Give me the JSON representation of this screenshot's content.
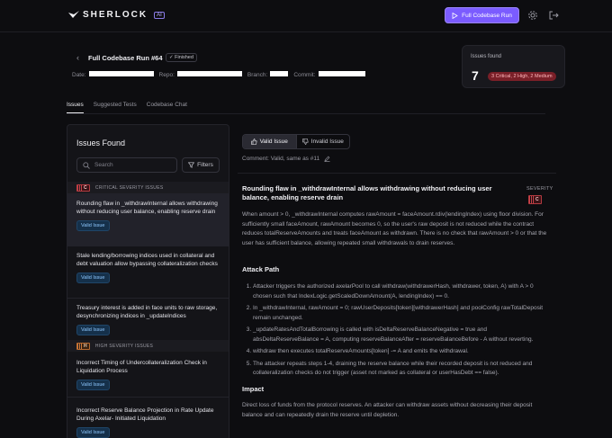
{
  "app": {
    "brand": "SHERLOCK",
    "ai_badge": "AI",
    "run_button": "Full Codebase Run"
  },
  "header": {
    "title": "Full Codebase Run #64",
    "status": "Finished",
    "meta": {
      "date_label": "Date",
      "repo_label": "Repo",
      "branch_label": "Branch",
      "commit_label": "Commit"
    }
  },
  "summary": {
    "label": "Issues found",
    "count": "7",
    "breakdown": "3 Critical, 2 High, 2 Medium"
  },
  "tabs": [
    "Issues",
    "Suggested Tests",
    "Codebase Chat"
  ],
  "issues_panel": {
    "title": "Issues Found",
    "search_placeholder": "Search",
    "filters_label": "Filters",
    "critical_header": "CRITICAL SEVERITY ISSUES",
    "high_header": "HIGH SEVERITY ISSUES",
    "severity_letters": {
      "critical": "C",
      "high": "H"
    },
    "items": [
      {
        "text": "Rounding flaw in _withdrawInternal allows withdrawing without reducing user balance, enabling reserve drain",
        "badge": "Valid Issue"
      },
      {
        "text": "Stale lending/borrowing indices used in collateral and debt valuation allow bypassing collateralization checks",
        "badge": "Valid Issue"
      },
      {
        "text": "Treasury interest is added in face units to raw storage, desynchronizing indices in _updateIndices",
        "badge": "Valid Issue"
      },
      {
        "text": "Incorrect Timing of Undercollateralization Check in Liquidation Process",
        "badge": "Valid Issue"
      },
      {
        "text": "Incorrect Reserve Balance Projection in Rate Update During Axelar- Initiated Liquidation",
        "badge": "Valid Issue"
      }
    ]
  },
  "detail": {
    "valid_button": "Valid Issue",
    "invalid_button": "Invalid Issue",
    "comment": "Comment: Valid, same as #11",
    "title": "Rounding flaw in _withdrawInternal allows withdrawing without reducing user balance, enabling reserve drain",
    "severity_label": "SEVERITY",
    "severity_letter": "C",
    "summary": "When amount > 0, _withdrawInternal computes rawAmount = faceAmount.rdiv(lendingIndex) using floor division. For sufficiently small faceAmount, rawAmount becomes 0, so the user's raw deposit is not reduced while the contract reduces totalReserveAmounts and treats faceAmount as withdrawn. There is no check that rawAmount > 0 or that the user has sufficient balance, allowing repeated small withdrawals to drain reserves.",
    "attack_heading": "Attack Path",
    "steps": [
      "Attacker triggers the authorized axelarPool to call withdraw(withdrawerHash, withdrawer, token, A) with A > 0 chosen such that IndexLogic.getScaledDownAmount(A, lendingIndex) == 0.",
      "In _withdrawInternal, rawAmount = 0; rawUserDeposits[token][withdrawerHash] and poolConfig rawTotalDeposit remain unchanged.",
      "_updateRatesAndTotalBorrowing is called with isDeltaReserveBalanceNegative = true and absDeltaReserveBalance = A, computing reserveBalanceAfter = reserveBalanceBefore - A without reverting.",
      "withdraw then executes totalReserveAmounts[token] -= A and emits the withdrawal.",
      "The attacker repeats steps 1-4, draining the reserve balance while their recorded deposit is not reduced and collateralization checks do not trigger (asset not marked as collateral or userHasDebt == false)."
    ],
    "impact_heading": "Impact",
    "impact": "Direct loss of funds from the protocol reserves. An attacker can withdraw assets without decreasing their deposit balance and can repeatedly drain the reserve until depletion."
  },
  "colors": {
    "accent": "#7b5cff",
    "critical": "#c94047",
    "high": "#d07a38",
    "valid": "#8ec8ff"
  }
}
